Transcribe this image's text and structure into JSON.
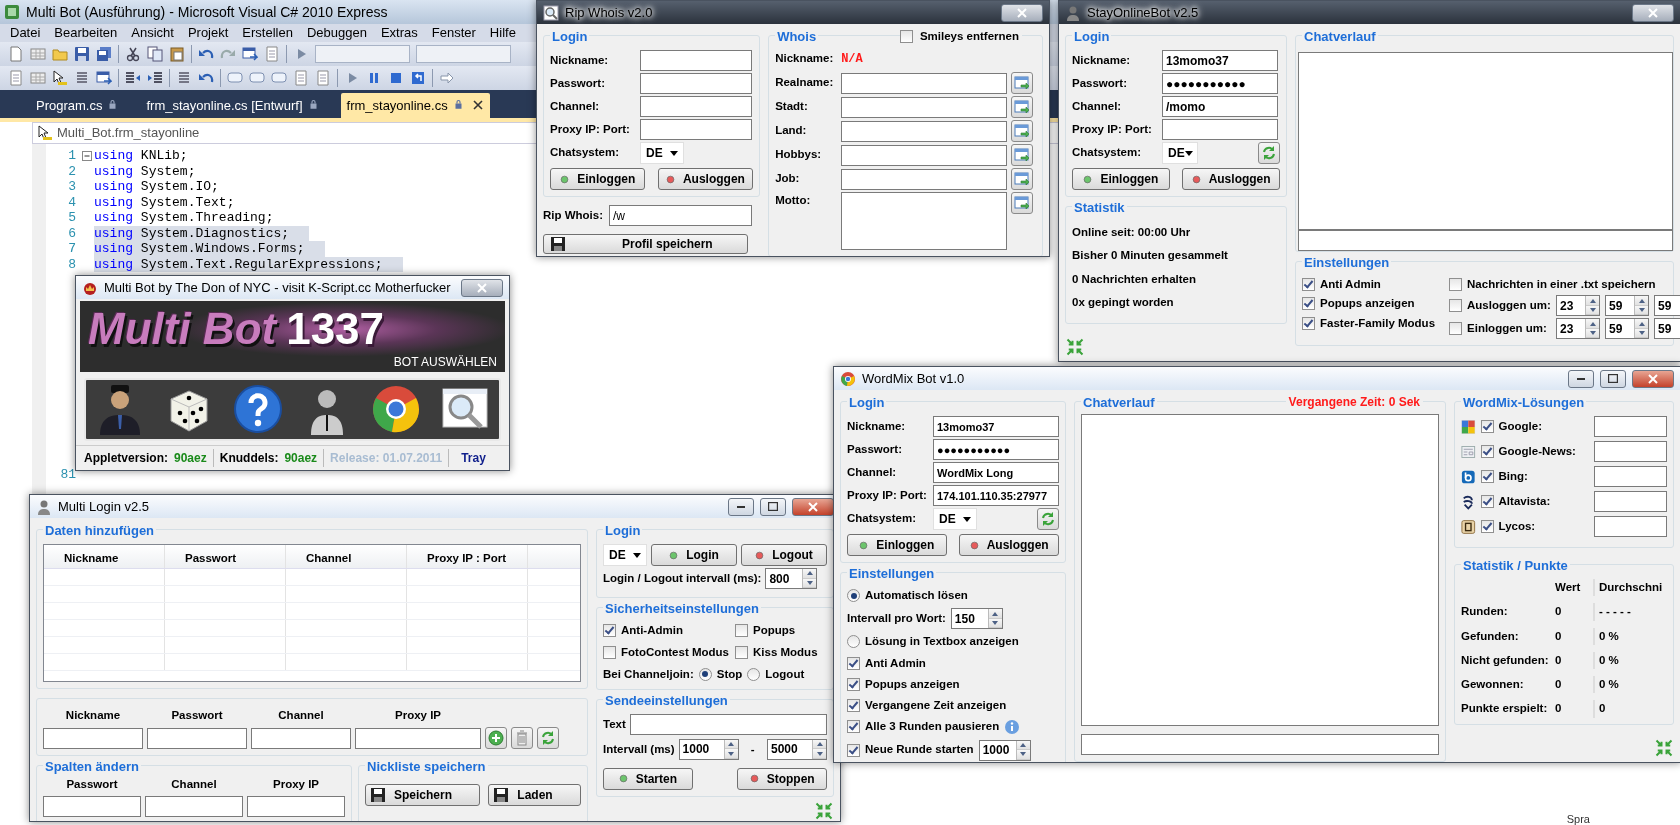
{
  "ide": {
    "title": "Multi Bot (Ausführung) - Microsoft Visual C# 2010 Express",
    "menu": [
      "Datei",
      "Bearbeiten",
      "Ansicht",
      "Projekt",
      "Erstellen",
      "Debuggen",
      "Extras",
      "Fenster",
      "Hilfe"
    ],
    "tabs": [
      {
        "label": "Program.cs",
        "selected": false
      },
      {
        "label": "frm_stayonline.cs [Entwurf]",
        "selected": false
      },
      {
        "label": "frm_stayonline.cs",
        "selected": true
      }
    ],
    "breadcrumb": "Multi_Bot.frm_stayonline",
    "code": [
      {
        "number": "1",
        "keyword": "using",
        "text": "KNLib;",
        "selected": false
      },
      {
        "number": "2",
        "keyword": "using",
        "text": "System;",
        "selected": false
      },
      {
        "number": "3",
        "keyword": "using",
        "text": "System.IO;",
        "selected": false
      },
      {
        "number": "4",
        "keyword": "using",
        "text": "System.Text;",
        "selected": false
      },
      {
        "number": "5",
        "keyword": "using",
        "text": "System.Threading;",
        "selected": false
      },
      {
        "number": "6",
        "keyword": "using",
        "text": "System.Diagnostics;",
        "selected": true
      },
      {
        "number": "7",
        "keyword": "using",
        "text": "System.Windows.Forms;",
        "selected": true
      },
      {
        "number": "8",
        "keyword": "using",
        "text": "System.Text.RegularExpressions;",
        "selected": true
      },
      {
        "number": "81"
      }
    ],
    "status_text": "Spra"
  },
  "ripwhois": {
    "title": "Rip Whois v2.0",
    "login": {
      "legend": "Login",
      "fields": [
        {
          "label": "Nickname:"
        },
        {
          "label": "Passwort:"
        },
        {
          "label": "Channel:"
        },
        {
          "label": "Proxy IP: Port:"
        }
      ],
      "chatsystem": {
        "label": "Chatsystem:",
        "value": "DE"
      },
      "buttons": [
        {
          "label": "Einloggen",
          "kind": "go"
        },
        {
          "label": "Ausloggen",
          "kind": "stop"
        }
      ]
    },
    "rip": {
      "label": "Rip Whois:",
      "value": "/w"
    },
    "save_button": "Profil speichern",
    "whois": {
      "legend": "Whois",
      "smileys": {
        "label": "Smileys entfernen",
        "checked": false
      },
      "nickname": {
        "label": "Nickname:",
        "value": "N/A"
      },
      "fields": [
        {
          "label": "Realname:",
          "kind": "line"
        },
        {
          "label": "Stadt:",
          "kind": "line"
        },
        {
          "label": "Land:",
          "kind": "line"
        },
        {
          "label": "Hobbys:",
          "kind": "line"
        },
        {
          "label": "Job:",
          "kind": "line"
        },
        {
          "label": "Motto:",
          "kind": "area"
        }
      ]
    }
  },
  "stayonline": {
    "title": "StayOnlineBot v2.5",
    "login": {
      "legend": "Login",
      "fields": [
        {
          "label": "Nickname:",
          "value": "13momo37"
        },
        {
          "label": "Passwort:",
          "value": "●●●●●●●●●●●"
        },
        {
          "label": "Channel:",
          "value": "/momo"
        },
        {
          "label": "Proxy IP: Port:"
        }
      ],
      "chatsystem": {
        "label": "Chatsystem:",
        "value": "DE"
      },
      "buttons": [
        {
          "label": "Einloggen",
          "kind": "go"
        },
        {
          "label": "Ausloggen",
          "kind": "stop"
        }
      ]
    },
    "statistik": {
      "legend": "Statistik",
      "lines": [
        "Online seit: 00:00 Uhr",
        "Bisher 0 Minuten gesammelt",
        "0 Nachrichten erhalten",
        "0x gepingt worden"
      ]
    },
    "chat": {
      "legend": "Chatverlauf"
    },
    "settings": {
      "legend": "Einstellungen",
      "options": [
        {
          "label": "Anti Admin",
          "checked": true
        },
        {
          "label": "Popups anzeigen",
          "checked": true
        },
        {
          "label": "Faster-Family Modus",
          "checked": true
        }
      ],
      "timers": [
        {
          "label": "Nachrichten in einer .txt speichern",
          "checked": false
        },
        {
          "label": "Ausloggen um:",
          "checked": false,
          "time": [
            "23",
            "59",
            "59"
          ]
        },
        {
          "label": "Einloggen um:",
          "checked": false,
          "time": [
            "23",
            "59",
            "59"
          ]
        }
      ]
    }
  },
  "multibot": {
    "title": "Multi Bot by The Don of NYC - visit K-Script.cc Motherfucker",
    "logo": "Multi Bot",
    "logo_number": "1337",
    "subtitle": "BOT AUSWÄHLEN",
    "status": [
      {
        "label": "Appletversion:",
        "value": "90aez",
        "kind": "version"
      },
      {
        "label": "Knuddels:",
        "value": "90aez",
        "kind": "version"
      },
      {
        "label": "Release: 01.07.2011",
        "kind": "info"
      },
      {
        "label": "Tray",
        "kind": "link"
      }
    ]
  },
  "multilogin": {
    "title": "Multi Login v2.5",
    "data": {
      "legend": "Daten hinzufügen",
      "columns": [
        "Nickname",
        "Passwort",
        "Channel",
        "Proxy IP : Port"
      ],
      "add_labels": [
        "Nickname",
        "Passwort",
        "Channel",
        "Proxy IP"
      ]
    },
    "columns_group": {
      "legend": "Spalten ändern",
      "labels": [
        "Passwort",
        "Channel",
        "Proxy IP"
      ]
    },
    "nicklist": {
      "legend": "Nickliste speichern",
      "buttons": [
        "Speichern",
        "Laden"
      ]
    },
    "login": {
      "legend": "Login",
      "chatsystem": "DE",
      "buttons": [
        {
          "label": "Login",
          "kind": "go"
        },
        {
          "label": "Logout",
          "kind": "stop"
        }
      ],
      "interval_label": "Login / Logout intervall (ms):",
      "interval": "800"
    },
    "security": {
      "legend": "Sicherheitseinstellungen",
      "options": [
        {
          "label": "Anti-Admin",
          "checked": true
        },
        {
          "label": "Popups",
          "checked": false
        },
        {
          "label": "FotoContest Modus",
          "checked": false
        },
        {
          "label": "Kiss Modus",
          "checked": false
        }
      ],
      "channeljoin": {
        "label": "Bei Channeljoin:",
        "options": [
          {
            "label": "Stop",
            "selected": true
          },
          {
            "label": "Logout",
            "selected": false
          }
        ]
      }
    },
    "send": {
      "legend": "Sendeeinstellungen",
      "text_label": "Text",
      "interval_label": "Intervall (ms)",
      "from": "1000",
      "separator": "-",
      "to": "5000",
      "buttons": [
        {
          "label": "Starten",
          "kind": "go"
        },
        {
          "label": "Stoppen",
          "kind": "stop"
        }
      ]
    }
  },
  "wordmix": {
    "title": "WordMix Bot v1.0",
    "login": {
      "legend": "Login",
      "fields": [
        {
          "label": "Nickname:",
          "value": "13momo37"
        },
        {
          "label": "Passwort:",
          "value": "●●●●●●●●●●●"
        },
        {
          "label": "Channel:",
          "value": "WordMix Long"
        },
        {
          "label": "Proxy IP: Port:",
          "value": "174.101.110.35:27977"
        }
      ],
      "chatsystem": {
        "label": "Chatsystem:",
        "value": "DE"
      },
      "buttons": [
        {
          "label": "Einloggen",
          "kind": "go"
        },
        {
          "label": "Ausloggen",
          "kind": "stop"
        }
      ]
    },
    "settings": {
      "legend": "Einstellungen",
      "items": [
        {
          "kind": "radio",
          "label": "Automatisch lösen",
          "selected": true
        },
        {
          "kind": "spin",
          "label": "Intervall pro Wort:",
          "value": "150"
        },
        {
          "kind": "radio",
          "label": "Lösung in Textbox anzeigen",
          "selected": false
        },
        {
          "kind": "check",
          "label": "Anti Admin",
          "checked": true
        },
        {
          "kind": "check",
          "label": "Popups anzeigen",
          "checked": true
        },
        {
          "kind": "check",
          "label": "Vergangene Zeit anzeigen",
          "checked": true
        },
        {
          "kind": "info",
          "label": "Alle 3 Runden pausieren",
          "checked": true
        },
        {
          "kind": "checkspin",
          "label": "Neue Runde starten",
          "checked": true,
          "value": "1000"
        }
      ]
    },
    "chat": {
      "legend": "Chatverlauf",
      "elapsed": "Vergangene Zeit: 0 Sek"
    },
    "solutions": {
      "legend": "WordMix-Lösungen",
      "engines": [
        {
          "label": "Google:",
          "checked": true
        },
        {
          "label": "Google-News:",
          "checked": true
        },
        {
          "label": "Bing:",
          "checked": true
        },
        {
          "label": "Altavista:",
          "checked": true
        },
        {
          "label": "Lycos:",
          "checked": true
        }
      ]
    },
    "stats": {
      "legend": "Statistik / Punkte",
      "columns": [
        "Wert",
        "Durchschni"
      ],
      "rows": [
        {
          "label": "Runden:",
          "value": "0",
          "average": "- - - - -"
        },
        {
          "label": "Gefunden:",
          "value": "0",
          "average": "0 %"
        },
        {
          "label": "Nicht gefunden:",
          "value": "0",
          "average": "0 %"
        },
        {
          "label": "Gewonnen:",
          "value": "0",
          "average": "0 %"
        },
        {
          "label": "Punkte erspielt:",
          "value": "0",
          "average": "0"
        }
      ]
    }
  }
}
